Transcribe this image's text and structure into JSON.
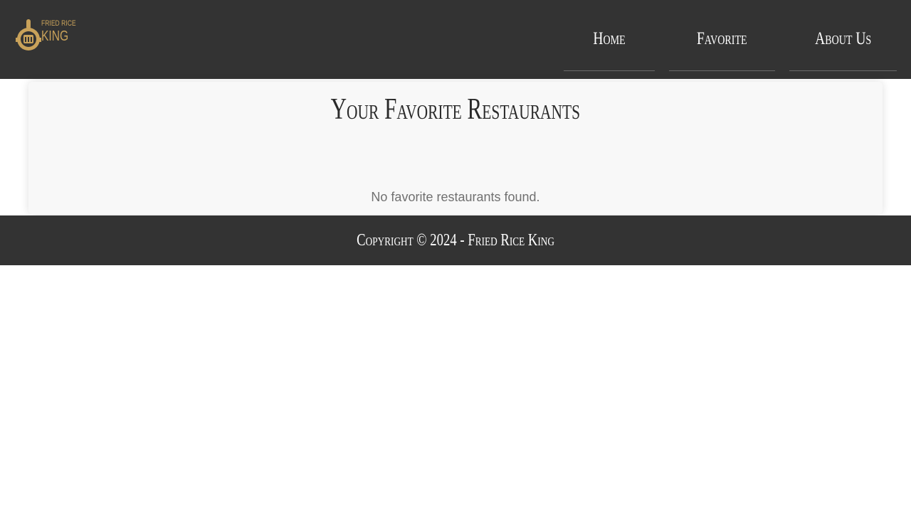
{
  "header": {
    "logo": {
      "line1": "FRIED RICE",
      "line2": "KING",
      "icon": "chef-hat-icon",
      "color": "#c9a25a"
    },
    "nav": [
      {
        "label": "Home"
      },
      {
        "label": "Favorite"
      },
      {
        "label": "About Us"
      }
    ],
    "background": "#333333"
  },
  "main": {
    "title": "Your Favorite Restaurants",
    "empty_message": "No favorite restaurants found."
  },
  "footer": {
    "text": "Copyright © 2024 - Fried Rice King"
  }
}
